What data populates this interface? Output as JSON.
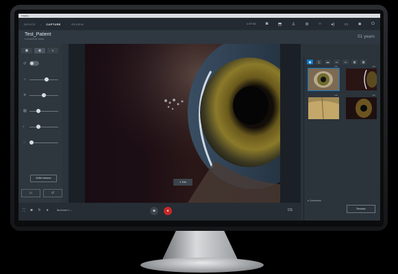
{
  "window": {
    "title": "Imaging"
  },
  "nav": {
    "breadcrumbs": [
      "DEVICE",
      "CAPTURE",
      "REVIEW"
    ],
    "active_index": 1,
    "date": "1.07.01",
    "icons": [
      "camera-icon",
      "export-icon",
      "user-icon",
      "settings-icon",
      "info-icon",
      "volume-icon",
      "display-icon",
      "gear-icon",
      "power-icon"
    ]
  },
  "patient": {
    "name": "Test_Patient",
    "meta": "F   1/1/1970 ID: 10001",
    "age": "51 years"
  },
  "left_panel": {
    "tabs": [
      "▣",
      "◉",
      "◒"
    ],
    "white_balance_label": "White balance",
    "sliders": [
      {
        "icon": "brightness-icon",
        "glyph": "☼",
        "value": 0.62
      },
      {
        "icon": "contrast-icon",
        "glyph": "✳",
        "value": 0.5
      },
      {
        "icon": "image-icon",
        "glyph": "▨",
        "value": 0.28
      },
      {
        "icon": "pen-icon",
        "glyph": "∕",
        "value": 0.27
      },
      {
        "icon": "focus-icon",
        "glyph": "◌",
        "value": 0.0
      }
    ]
  },
  "viewer": {
    "zoom_label": "10x",
    "zoom_icon": "magnifier-icon"
  },
  "bottom_bar": {
    "dropdown": "Illuminator 1",
    "right_label": "OS"
  },
  "right_panel": {
    "tabs": [
      "▣",
      "◫",
      "▬",
      "▭",
      "▭",
      "▦",
      "▩"
    ],
    "thumbnail_labels": [
      "10x",
      "10x",
      "10x",
      "10x"
    ],
    "comments_label": "Comments",
    "review_label": "Review"
  },
  "colors": {
    "accent": "#0e79c9",
    "record": "#c62a2a"
  }
}
